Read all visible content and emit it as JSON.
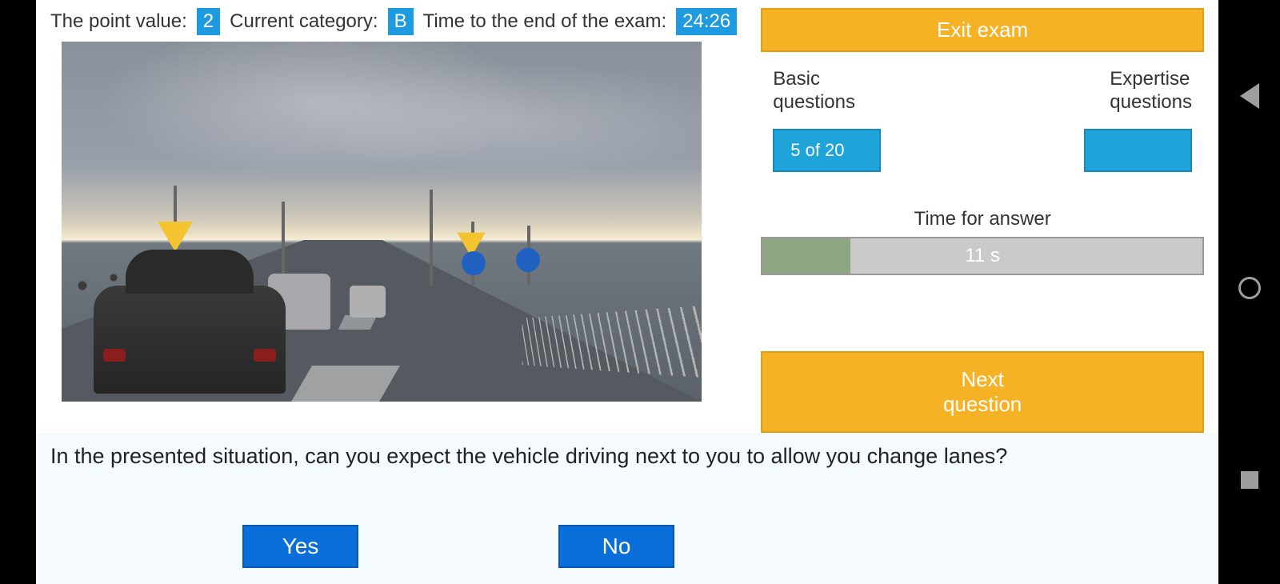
{
  "info": {
    "points_label": "The point value:",
    "points_value": "2",
    "category_label": "Current category:",
    "category_value": "B",
    "time_label": "Time to the end of the exam:",
    "time_value": "24:26"
  },
  "exit_button": "Exit exam",
  "question_types": {
    "basic_label": "Basic\nquestions",
    "expertise_label": "Expertise\nquestions",
    "basic_progress": "5 of 20",
    "expertise_progress": ""
  },
  "answer_timer": {
    "label": "Time for answer",
    "value": "11 s",
    "fill_percent": 20
  },
  "next_button": "Next\nquestion",
  "question": "In the presented situation, can you expect the vehicle driving next to you to allow you change lanes?",
  "answers": {
    "yes": "Yes",
    "no": "No"
  }
}
